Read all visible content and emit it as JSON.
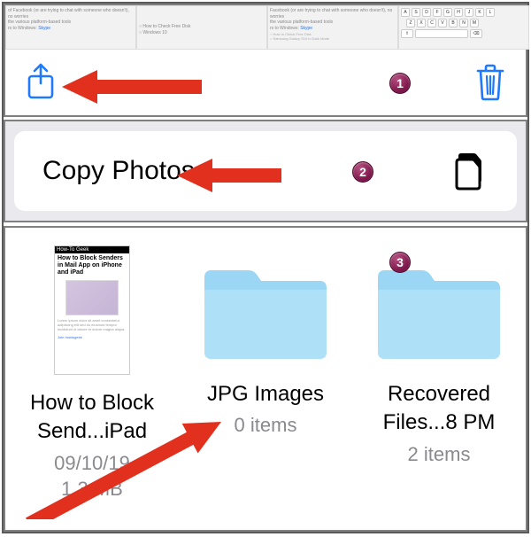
{
  "switcher": {
    "tabs": [
      {
        "line1": "of Facebook (or are trying to chat with someone who doesn't), no worries",
        "line2": "the various platform-based tools",
        "line3_prefix": "rs to Windows: ",
        "link": "Skype"
      },
      {
        "line2": "How to Check Free Disk",
        "line3": "Windows 10"
      },
      {
        "line1": "Facebook (or are trying to chat with someone who doesn't), no worries",
        "line2": "the various platform-based tools",
        "line3_prefix": "rs to Windows: ",
        "link": "Skype",
        "aux1": "How to Check Free Disk",
        "aux2": "Samsung Galaxy S10 in Dark Mode"
      },
      {
        "keys_row1": [
          "A",
          "S",
          "D",
          "F",
          "G",
          "H",
          "J",
          "K",
          "L"
        ],
        "keys_row2": [
          "Z",
          "X",
          "C",
          "V",
          "B",
          "N",
          "M"
        ]
      }
    ]
  },
  "share_sheet": {
    "label": "Copy Photos"
  },
  "files": {
    "items": [
      {
        "name_line1": "How to Block",
        "name_line2": "Send...iPad",
        "meta_line1": "09/10/19",
        "meta_line2": "1.3 MB",
        "thumb_header": "How-To Geek",
        "thumb_title": "How to Block Senders in Mail App on iPhone and iPad"
      },
      {
        "name_line1": "JPG Images",
        "meta_line1": "0 items"
      },
      {
        "name_line1": "Recovered",
        "name_line2": "Files...8 PM",
        "meta_line1": "2 items"
      }
    ]
  },
  "annotations": {
    "badge1": "1",
    "badge2": "2",
    "badge3": "3"
  }
}
